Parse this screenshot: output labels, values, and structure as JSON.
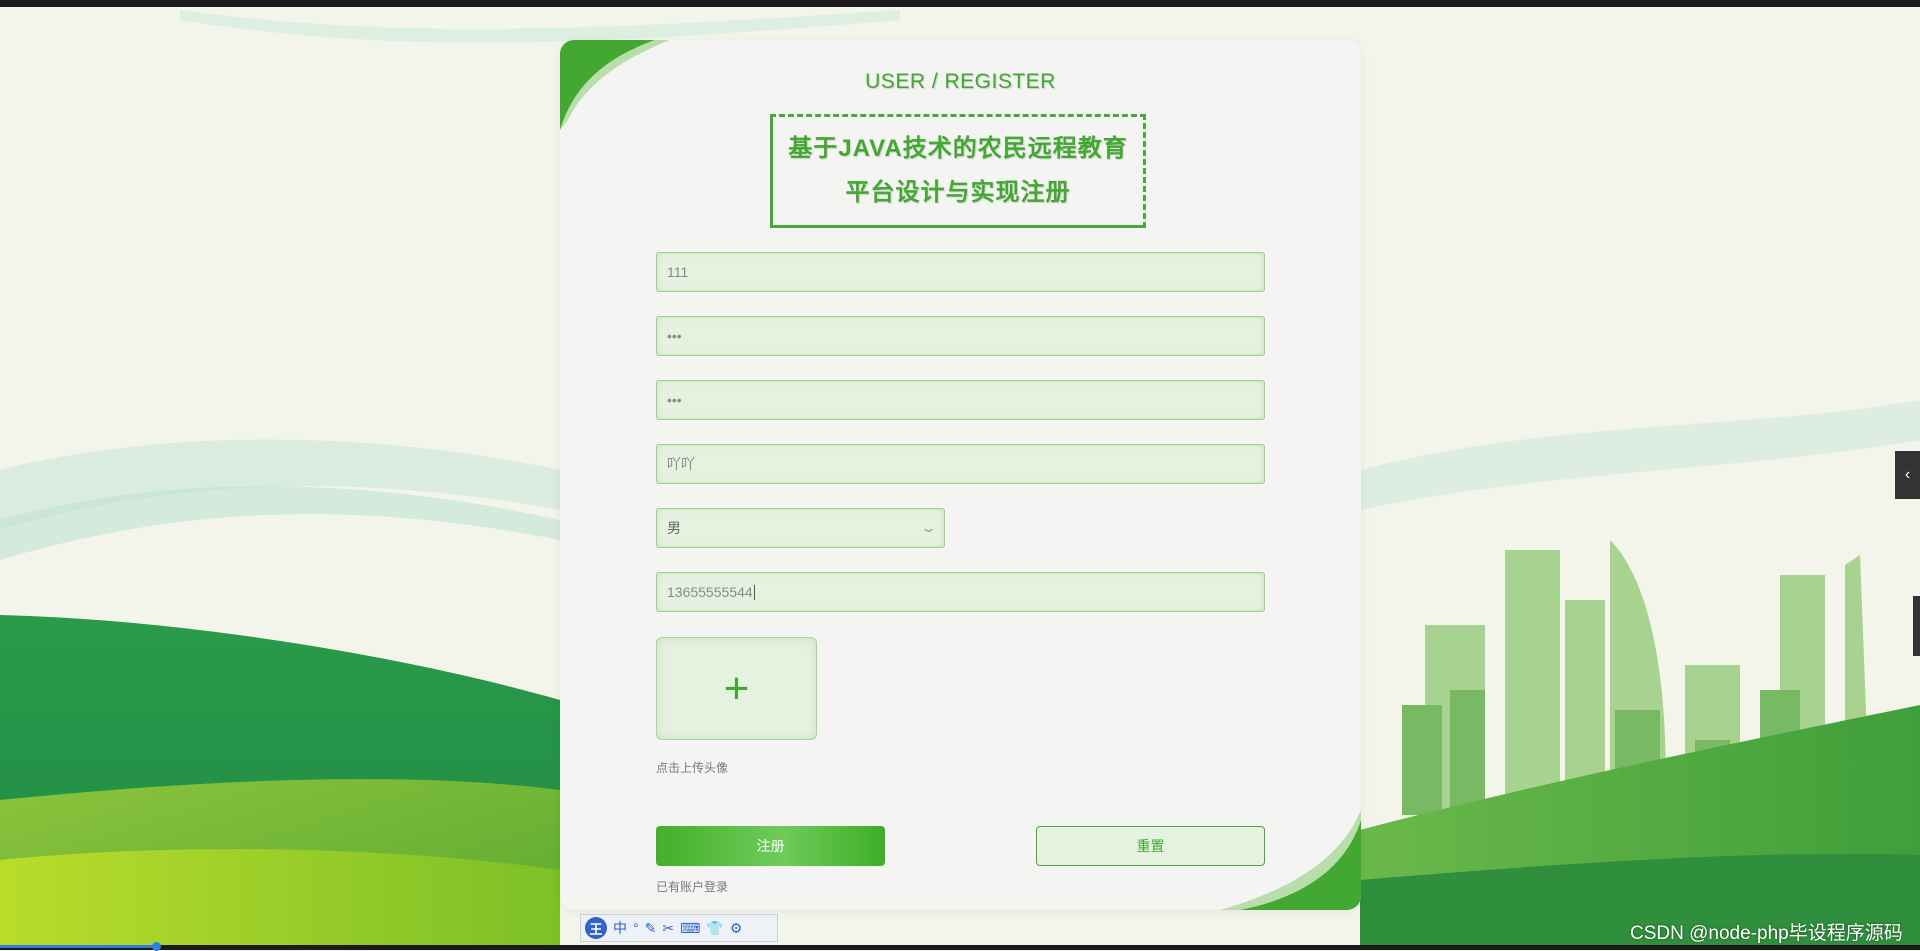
{
  "header": {
    "subtitle": "USER / REGISTER",
    "title": "基于JAVA技术的农民远程教育平台设计与实现注册"
  },
  "form": {
    "account": "111",
    "password": "•••",
    "confirm_password": "•••",
    "name": "吖吖",
    "gender_selected": "男",
    "phone": "13655555544",
    "upload_hint": "点击上传头像",
    "register_label": "注册",
    "reset_label": "重置",
    "login_link": "已有账户登录"
  },
  "ime_toolbar": {
    "logo": "王",
    "items": [
      "中",
      "°",
      "✎",
      "✂",
      "⌨",
      "👕",
      "⚙"
    ]
  },
  "side_tab": {
    "label": "‹"
  },
  "watermark": "CSDN @node-php毕设程序源码",
  "icons": {
    "upload": "plus-icon",
    "select": "chevron-down-icon",
    "side": "chevron-left-icon"
  },
  "colors": {
    "accent": "#43a832",
    "field_bg": "#e6f2e0",
    "field_border": "#9ed08c",
    "card_bg": "#f4f5f3"
  }
}
